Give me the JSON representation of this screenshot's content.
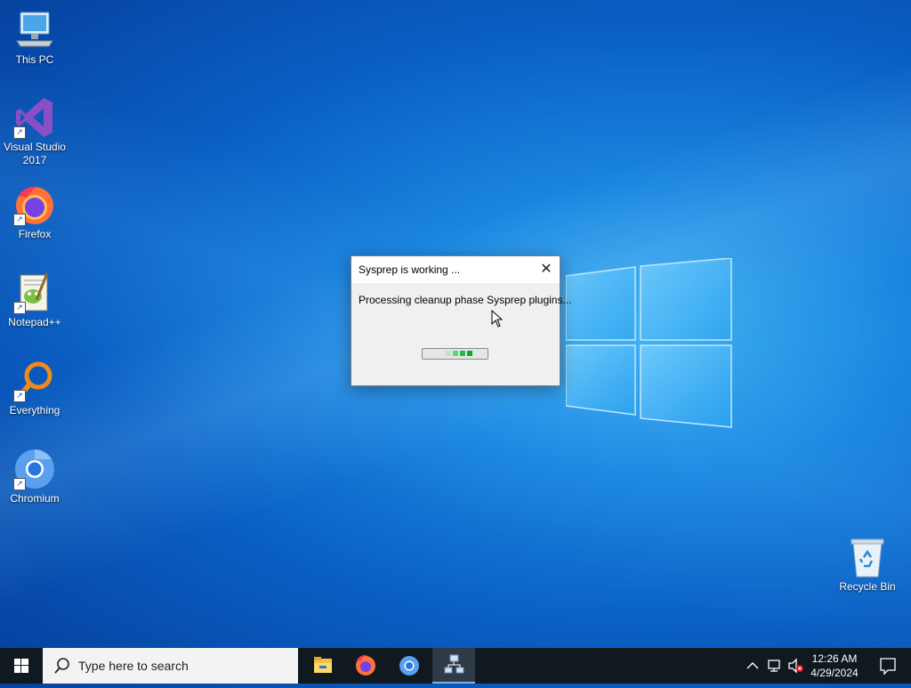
{
  "desktop": {
    "icons": [
      {
        "label": "This PC",
        "icon": "computer-icon"
      },
      {
        "label": "Visual Studio\n2017",
        "icon": "visual-studio-icon"
      },
      {
        "label": "Firefox",
        "icon": "firefox-icon"
      },
      {
        "label": "Notepad++",
        "icon": "notepadpp-icon"
      },
      {
        "label": "Everything",
        "icon": "everything-icon"
      },
      {
        "label": "Chromium",
        "icon": "chromium-icon"
      },
      {
        "label": "Recycle Bin",
        "icon": "recycle-bin-icon"
      }
    ]
  },
  "dialog": {
    "title": "Sysprep is working ...",
    "close_label": "✕",
    "message": "Processing cleanup phase Sysprep plugins...",
    "progress": "indeterminate",
    "progress_color": "#06b025"
  },
  "taskbar": {
    "search_placeholder": "Type here to search",
    "apps": [
      {
        "name": "File Explorer",
        "icon": "folder-icon"
      },
      {
        "name": "Firefox",
        "icon": "firefox-icon"
      },
      {
        "name": "Chromium",
        "icon": "chromium-icon"
      },
      {
        "name": "Sysprep",
        "icon": "sysprep-icon",
        "active": true
      }
    ],
    "tray": {
      "time": "12:26 AM",
      "date": "4/29/2024"
    }
  },
  "colors": {
    "accent": "#0a64d0",
    "taskbar": "#101820"
  }
}
